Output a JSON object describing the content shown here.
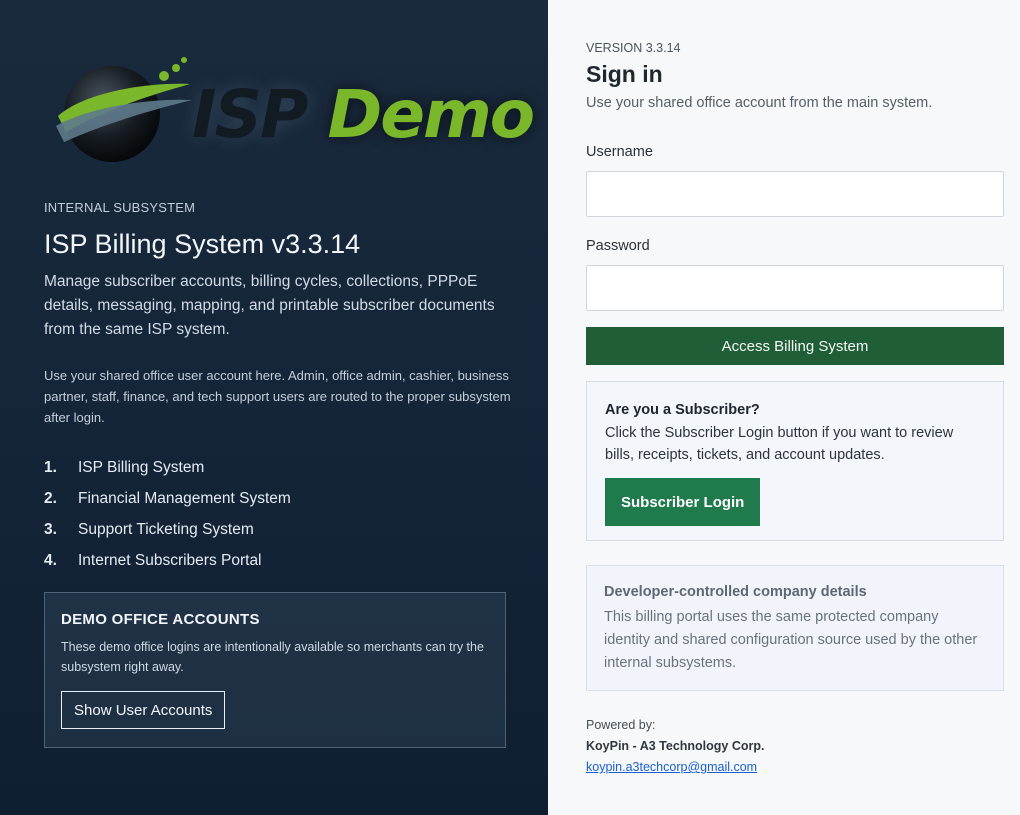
{
  "brand": {
    "logo_part1": "ISP",
    "logo_part2": "Demo",
    "accent_color": "#7ab72a"
  },
  "left": {
    "kicker": "INTERNAL SUBSYSTEM",
    "title": "ISP Billing System v3.3.14",
    "description": "Manage subscriber accounts, billing cycles, collections, PPPoE details, messaging, mapping, and printable subscriber documents from the same ISP system.",
    "note": "Use your shared office user account here. Admin, office admin, cashier, business partner, staff, finance, and tech support users are routed to the proper subsystem after login.",
    "systems": [
      {
        "num": "1.",
        "label": "ISP Billing System"
      },
      {
        "num": "2.",
        "label": "Financial Management System"
      },
      {
        "num": "3.",
        "label": "Support Ticketing System"
      },
      {
        "num": "4.",
        "label": "Internet Subscribers Portal"
      }
    ],
    "demo": {
      "title": "DEMO OFFICE ACCOUNTS",
      "text": "These demo office logins are intentionally available so merchants can try the subsystem right away.",
      "button": "Show User Accounts"
    }
  },
  "right": {
    "version": "VERSION 3.3.14",
    "heading": "Sign in",
    "subheading": "Use your shared office account from the main system.",
    "username_label": "Username",
    "username_value": "",
    "password_label": "Password",
    "password_value": "",
    "submit_label": "Access Billing System",
    "subscriber": {
      "title": "Are you a Subscriber?",
      "text": "Click the Subscriber Login button if you want to review bills, receipts, tickets, and account updates.",
      "button": "Subscriber Login"
    },
    "developer": {
      "title": "Developer-controlled company details",
      "text": "This billing portal uses the same protected company identity and shared configuration source used by the other internal subsystems."
    },
    "footer": {
      "powered_by": "Powered by:",
      "company": "KoyPin - A3 Technology Corp.",
      "email": "koypin.a3techcorp@gmail.com"
    }
  },
  "colors": {
    "primary_green": "#1f5e36",
    "subscriber_green": "#1f7a4c",
    "left_bg": "#16263a",
    "link_blue": "#1a5fd0"
  }
}
